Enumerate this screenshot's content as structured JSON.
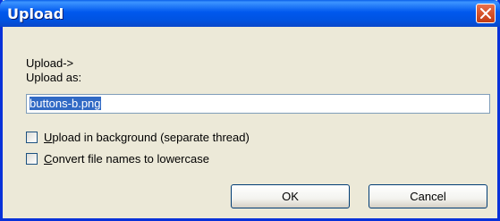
{
  "window": {
    "title": "Upload",
    "close_icon": "close-icon"
  },
  "form": {
    "upload_to_label": "Upload->",
    "upload_as_label": "Upload as:",
    "filename_value": "buttons-b.png",
    "options": [
      {
        "label_accel": "U",
        "label_rest": "pload in background (separate thread)",
        "checked": false
      },
      {
        "label_accel": "C",
        "label_rest": "onvert file names to lowercase",
        "checked": false
      }
    ]
  },
  "buttons": {
    "ok_label": "OK",
    "cancel_label": "Cancel"
  },
  "colors": {
    "titlebar": "#0058ee",
    "close_button": "#d6542a",
    "dialog_background": "#ece9d8",
    "selection": "#316ac5"
  }
}
